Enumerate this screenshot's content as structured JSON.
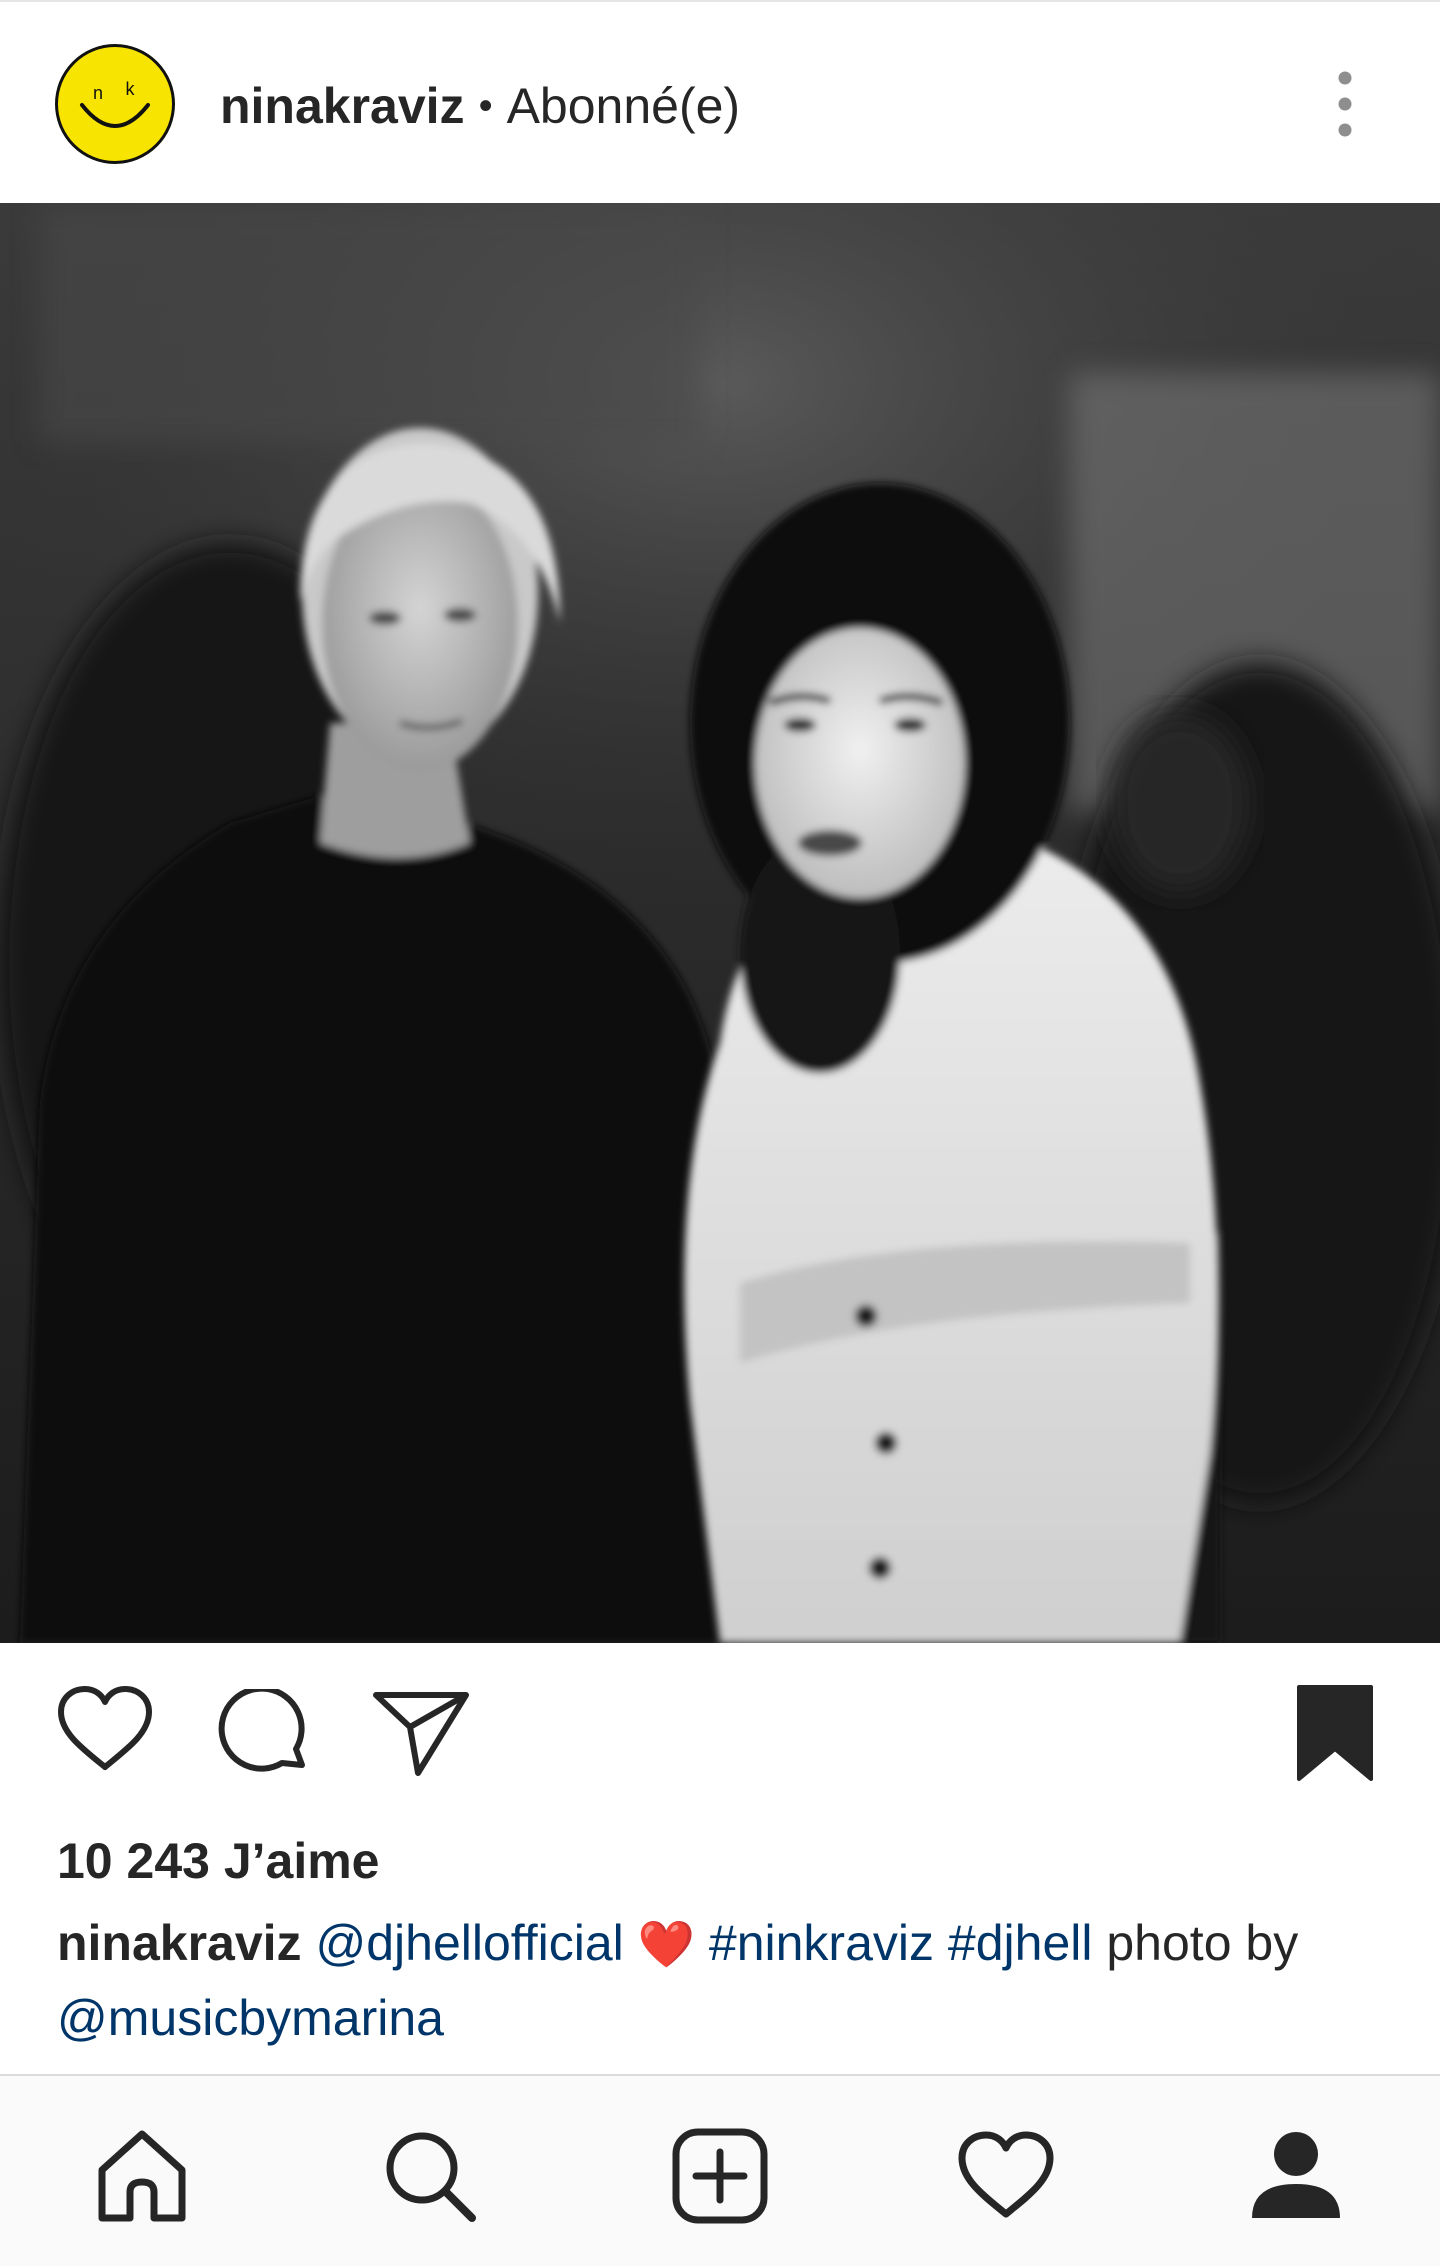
{
  "post": {
    "username": "ninakraviz",
    "separator": "•",
    "follow_status": "Abonné(e)",
    "avatar_letters": [
      "n",
      "k"
    ],
    "likes_text": "10 243 J’aime",
    "caption": {
      "username": "ninakraviz",
      "mention_1": "@djhellofficial",
      "emoji": "❤️",
      "hashtag_1": "#ninkraviz",
      "hashtag_2": "#djhell",
      "text_1": "photo by",
      "mention_2": "@musicbymarina"
    }
  },
  "icons": {
    "more": "more-vertical-icon",
    "like": "heart-icon",
    "comment": "comment-icon",
    "share": "send-icon",
    "save": "bookmark-icon",
    "nav_home": "home-icon",
    "nav_search": "search-icon",
    "nav_add": "add-post-icon",
    "nav_activity": "heart-icon",
    "nav_profile": "profile-icon"
  },
  "colors": {
    "avatar_bg": "#f7e400",
    "link": "#003569",
    "text": "#262626",
    "heart_emoji": "#e0245e"
  }
}
